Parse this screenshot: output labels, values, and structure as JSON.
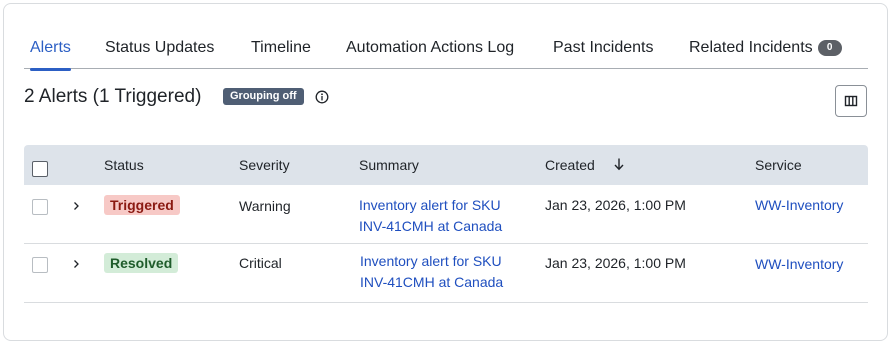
{
  "tabs": [
    {
      "label": "Alerts"
    },
    {
      "label": "Status Updates"
    },
    {
      "label": "Timeline"
    },
    {
      "label": "Automation Actions Log"
    },
    {
      "label": "Past Incidents"
    },
    {
      "label": "Related Incidents",
      "badge": "0"
    }
  ],
  "active_tab": "Alerts",
  "heading": {
    "title": "2 Alerts (1 Triggered)",
    "grouping_badge": "Grouping off"
  },
  "table": {
    "columns": [
      "Status",
      "Severity",
      "Summary",
      "Created",
      "Service"
    ],
    "sorted_column": "Created",
    "sort_direction": "descending",
    "rows": [
      {
        "status": "Triggered",
        "severity": "Warning",
        "summary_line1": "Inventory alert for SKU",
        "summary_line2": "INV-41CMH at Canada",
        "created": "Jan 23, 2026, 1:00 PM",
        "service": "WW-Inventory"
      },
      {
        "status": "Resolved",
        "severity": "Critical",
        "summary_line1": "Inventory alert for SKU",
        "summary_line2": "INV-41CMH at Canada",
        "created": "Jan 23, 2026, 1:00 PM",
        "service": "WW-Inventory"
      }
    ]
  },
  "colors": {
    "accent": "#2c5fc4",
    "triggered_bg": "#f7c9c6",
    "resolved_bg": "#d3ecd8",
    "header_bg": "#dde3ea"
  }
}
